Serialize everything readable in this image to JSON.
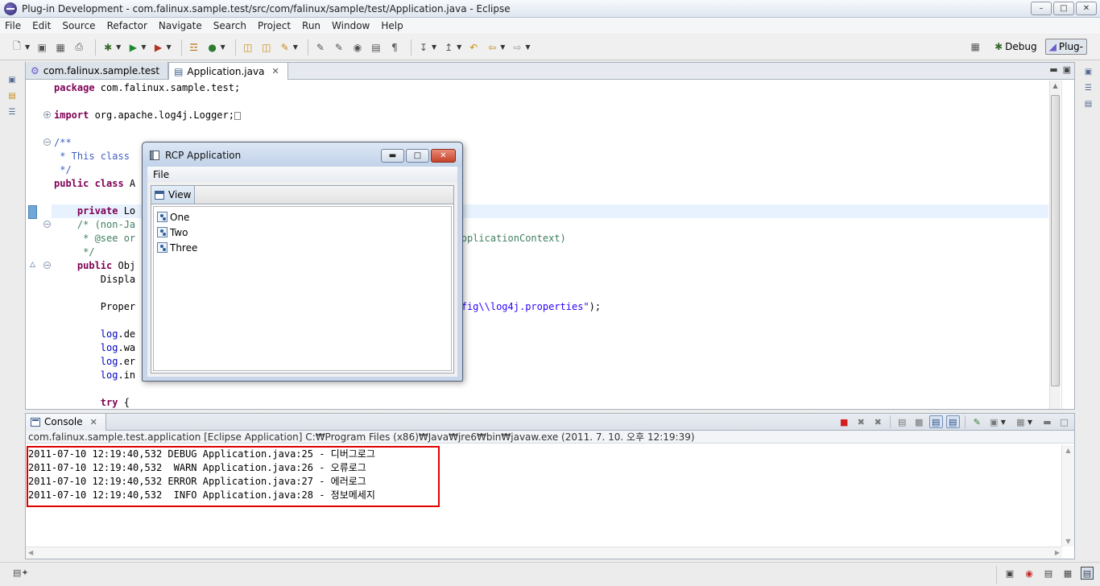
{
  "window": {
    "title": "Plug-in Development - com.falinux.sample.test/src/com/falinux/sample/test/Application.java - Eclipse",
    "buttons": {
      "minimize": "–",
      "maximize": "□",
      "close": "✕"
    }
  },
  "menu": [
    "File",
    "Edit",
    "Source",
    "Refactor",
    "Navigate",
    "Search",
    "Project",
    "Run",
    "Window",
    "Help"
  ],
  "perspectives": {
    "debug": "Debug",
    "plugin": "Plug-"
  },
  "editor": {
    "tabs": [
      {
        "label": "com.falinux.sample.test",
        "active": false
      },
      {
        "label": "Application.java",
        "active": true
      }
    ],
    "lines": [
      [
        "package com.falinux.sample.test;"
      ],
      [
        ""
      ],
      [
        "import org.apache.log4j.Logger;□"
      ],
      [
        ""
      ],
      [
        "/**"
      ],
      [
        " * This class                                                       n"
      ],
      [
        " */"
      ],
      [
        "public class A"
      ],
      [
        ""
      ],
      [
        "    private Lo"
      ],
      [
        "    /* (non-Ja"
      ],
      [
        "     * @see or                                      pse.equinox.app.IApplicationContext)"
      ],
      [
        "     */"
      ],
      [
        "    public Obj"
      ],
      [
        "        Displa"
      ],
      [
        ""
      ],
      [
        "        Proper                                      dir\")+\"\\\\user\\\\config\\\\log4j.properties\");"
      ],
      [
        ""
      ],
      [
        "        log.de"
      ],
      [
        "        log.wa"
      ],
      [
        "        log.er"
      ],
      [
        "        log.in"
      ],
      [
        ""
      ],
      [
        "        try {"
      ]
    ]
  },
  "rcp_dialog": {
    "title": "RCP Application",
    "menu": "File",
    "view_tab": "View",
    "items": [
      "One",
      "Two",
      "Three"
    ]
  },
  "console": {
    "tab": "Console",
    "description": "com.falinux.sample.test.application [Eclipse Application] C:₩Program Files (x86)₩Java₩jre6₩bin₩javaw.exe (2011. 7. 10. 오후 12:19:39)",
    "output": [
      "2011-07-10 12:19:40,532 DEBUG Application.java:25 - 디버그로그",
      "2011-07-10 12:19:40,532  WARN Application.java:26 - 오류로그",
      "2011-07-10 12:19:40,532 ERROR Application.java:27 - 에러로그",
      "2011-07-10 12:19:40,532  INFO Application.java:28 - 정보메세지"
    ]
  },
  "colors": {
    "keyword": "#7f0055",
    "comment": "#3f7f5f",
    "javadoc": "#3f5fbf",
    "string": "#2a00ff",
    "highlight_box": "#e00000"
  }
}
